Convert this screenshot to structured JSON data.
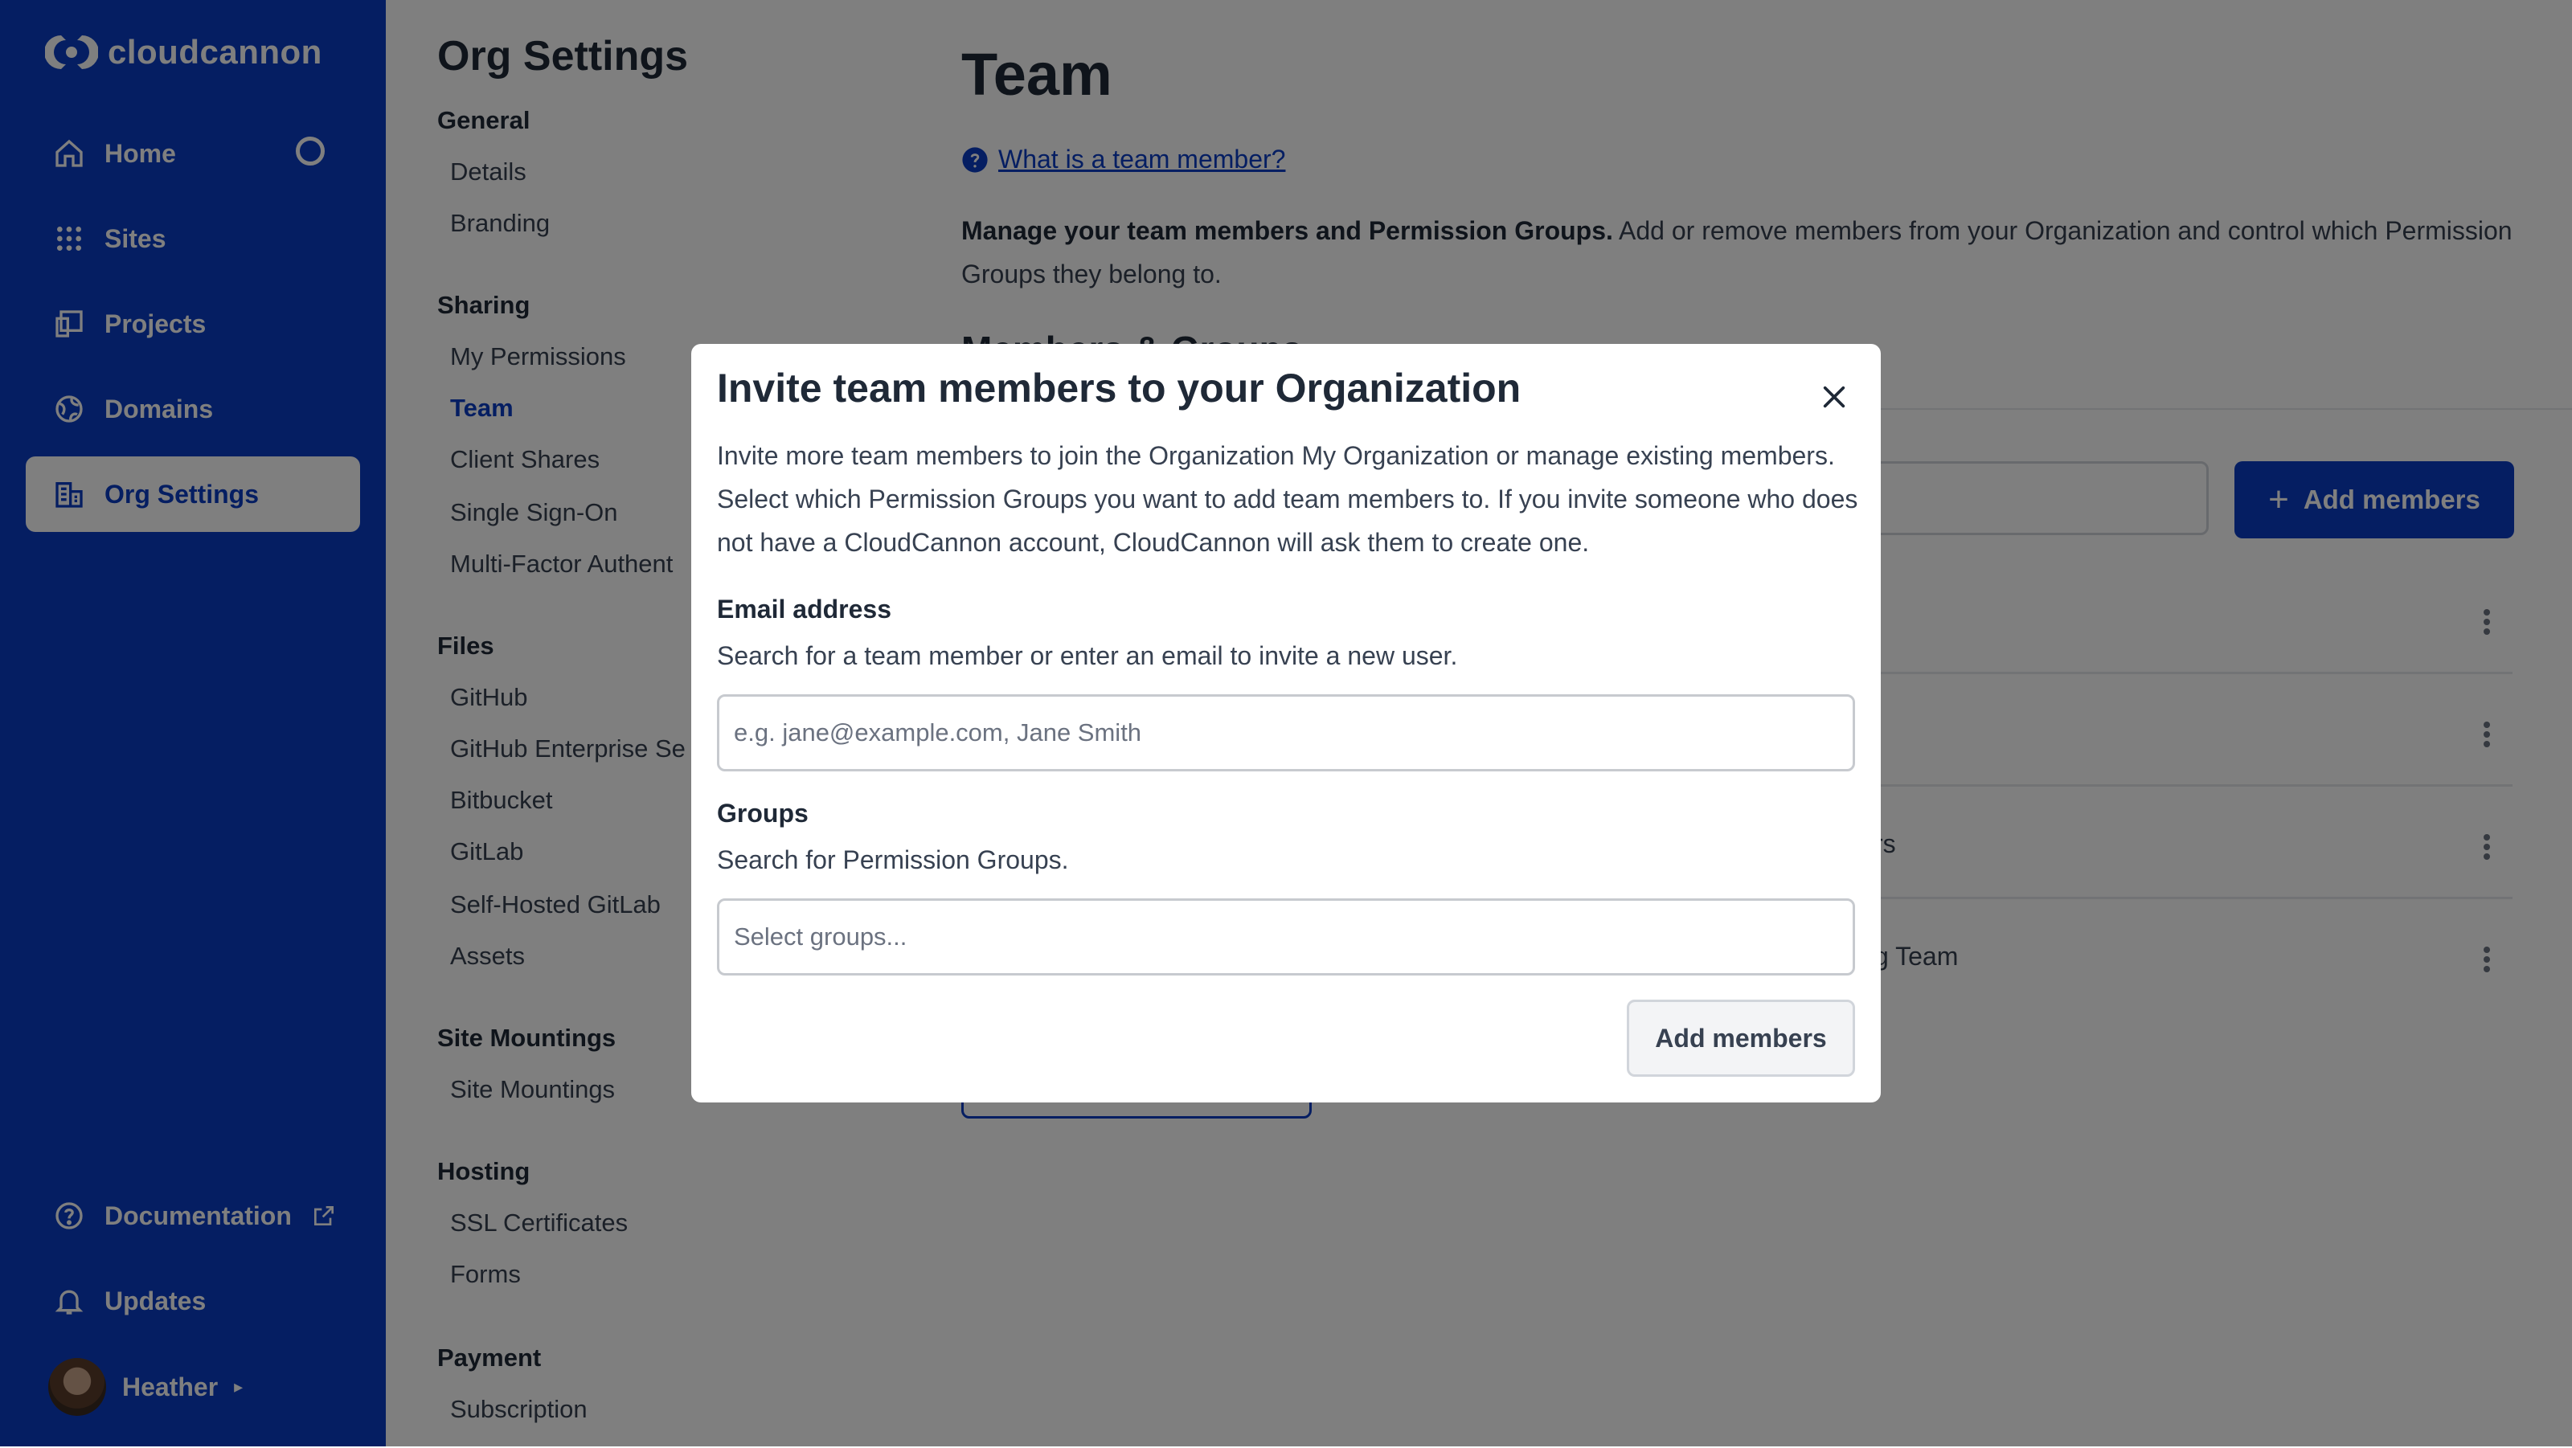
{
  "brand": {
    "name": "cloudcannon",
    "accent": "#0a3cc5"
  },
  "sidebar": {
    "items": [
      {
        "label": "Home",
        "icon": "home-icon"
      },
      {
        "label": "Sites",
        "icon": "grid-icon"
      },
      {
        "label": "Projects",
        "icon": "projects-icon"
      },
      {
        "label": "Domains",
        "icon": "globe-icon"
      },
      {
        "label": "Org Settings",
        "icon": "org-settings-icon",
        "active": true
      }
    ],
    "bottom": [
      {
        "label": "Documentation",
        "icon": "help-circle-icon"
      },
      {
        "label": "Updates",
        "icon": "bell-icon"
      }
    ],
    "user": {
      "name": "Heather"
    }
  },
  "settings": {
    "title": "Org Settings",
    "sections": [
      {
        "heading": "General",
        "links": [
          "Details",
          "Branding"
        ]
      },
      {
        "heading": "Sharing",
        "links": [
          "My Permissions",
          "Team",
          "Client Shares",
          "Single Sign-On",
          "Multi-Factor Authent"
        ]
      },
      {
        "heading": "Files",
        "links": [
          "GitHub",
          "GitHub Enterprise Se",
          "Bitbucket",
          "GitLab",
          "Self-Hosted GitLab",
          "Assets"
        ]
      },
      {
        "heading": "Site Mountings",
        "links": [
          "Site Mountings"
        ]
      },
      {
        "heading": "Hosting",
        "links": [
          "SSL Certificates",
          "Forms"
        ]
      },
      {
        "heading": "Payment",
        "links": [
          "Subscription"
        ]
      }
    ],
    "active_link": "Team"
  },
  "main": {
    "title": "Team",
    "help_link": "What is a team member?",
    "desc_bold": "Manage your team members and Permission Groups.",
    "desc_rest": " Add or remove members from your Organization and control which Permission Groups they belong to.",
    "subheading": "Members & Groups",
    "add_members_label": "Add members",
    "row_fragments": [
      "rs",
      "g Team"
    ]
  },
  "modal": {
    "title": "Invite team members to your Organization",
    "description": "Invite more team members to join the Organization My Organization or manage existing members. Select which Permission Groups you want to add team members to. If you invite someone who does not have a CloudCannon account, CloudCannon will ask them to create one.",
    "email": {
      "label": "Email address",
      "help": "Search for a team member or enter an email to invite a new user.",
      "placeholder": "e.g. jane@example.com, Jane Smith",
      "value": ""
    },
    "groups": {
      "label": "Groups",
      "help": "Search for Permission Groups.",
      "placeholder": "Select groups...",
      "value": ""
    },
    "submit_label": "Add members"
  }
}
